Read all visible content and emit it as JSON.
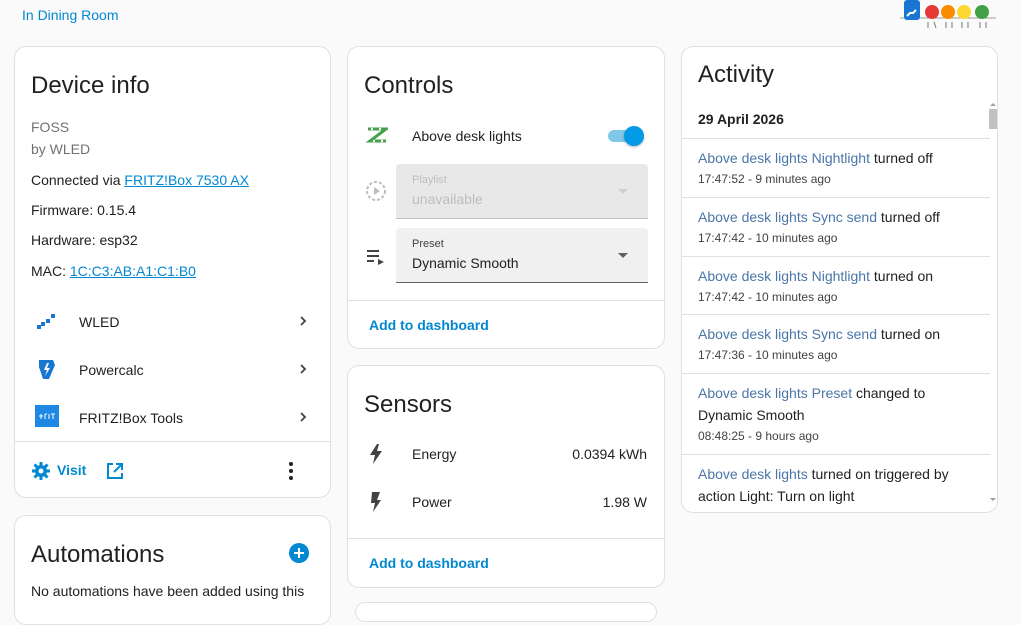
{
  "header": {
    "area_link": "In Dining Room"
  },
  "device_info": {
    "title": "Device info",
    "manufacturer": "FOSS",
    "by": "by WLED",
    "connected_prefix": "Connected via",
    "connected_link": "FRITZ!Box 7530 AX",
    "firmware": "Firmware: 0.15.4",
    "hardware": "Hardware: esp32",
    "mac_prefix": "MAC:",
    "mac_link": "1C:C3:AB:A1:C1:B0",
    "integrations": [
      {
        "label": "WLED",
        "icon": "wled-icon"
      },
      {
        "label": "Powercalc",
        "icon": "powercalc-icon"
      },
      {
        "label": "FRITZ!Box Tools",
        "icon": "fritzbox-icon"
      }
    ],
    "visit_label": "Visit"
  },
  "automations": {
    "title": "Automations",
    "empty_text": "No automations have been added using this"
  },
  "controls": {
    "title": "Controls",
    "light_label": "Above desk lights",
    "light_on": true,
    "playlist": {
      "label": "Playlist",
      "value": "unavailable"
    },
    "preset": {
      "label": "Preset",
      "value": "Dynamic Smooth"
    },
    "add_to_dashboard": "Add to dashboard"
  },
  "sensors": {
    "title": "Sensors",
    "items": [
      {
        "label": "Energy",
        "value": "0.0394 kWh",
        "icon": "flash-icon"
      },
      {
        "label": "Power",
        "value": "1.98 W",
        "icon": "power-bolt-icon"
      }
    ],
    "add_to_dashboard": "Add to dashboard"
  },
  "activity": {
    "title": "Activity",
    "date": "29 April 2026",
    "entries": [
      {
        "entity": "Above desk lights Nightlight",
        "action": " turned off",
        "time": "17:47:52 - 9 minutes ago"
      },
      {
        "entity": "Above desk lights Sync send",
        "action": " turned off",
        "time": "17:47:42 - 10 minutes ago"
      },
      {
        "entity": "Above desk lights Nightlight",
        "action": " turned on",
        "time": "17:47:42 - 10 minutes ago"
      },
      {
        "entity": "Above desk lights Sync send",
        "action": " turned on",
        "time": "17:47:36 - 10 minutes ago"
      },
      {
        "entity": "Above desk lights Preset",
        "action": " changed to Dynamic Smooth",
        "time": "08:48:25 - 9 hours ago"
      },
      {
        "entity": "Above desk lights",
        "action": " turned on triggered by action Light: Turn on light",
        "time": ""
      }
    ]
  },
  "colors": {
    "accent": "#0288d1",
    "toggle": "#039be5",
    "activity_link": "#4a76a8"
  }
}
